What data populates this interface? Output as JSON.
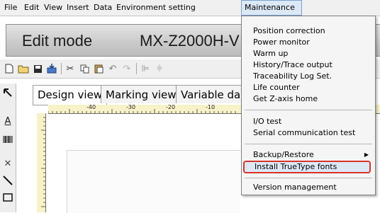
{
  "menubar": {
    "items": [
      "File",
      "Edit",
      "View",
      "Insert",
      "Data",
      "Environment setting",
      "Maintenance"
    ]
  },
  "title": {
    "mode": "Edit mode",
    "model": "MX-Z2000H-V"
  },
  "tabs": [
    "Design view",
    "Marking view",
    "Variable da"
  ],
  "ruler": {
    "top_labels": [
      "-40",
      "-30",
      "-20",
      "-10"
    ]
  },
  "maintenance_menu": {
    "group1": [
      "Position correction",
      "Power monitor",
      "Warm up",
      "History/Trace output",
      "Traceability Log Set.",
      "Life counter",
      "Get Z-axis home"
    ],
    "group2": [
      "I/O test",
      "Serial communication test"
    ],
    "group3": [
      "Backup/Restore",
      "Install TrueType fonts"
    ],
    "group4": [
      "Version management"
    ]
  },
  "colors": {
    "highlight_border": "#d9342c",
    "highlight_fill": "#dde8f7",
    "ruler_fill": "#f7f2c8"
  }
}
